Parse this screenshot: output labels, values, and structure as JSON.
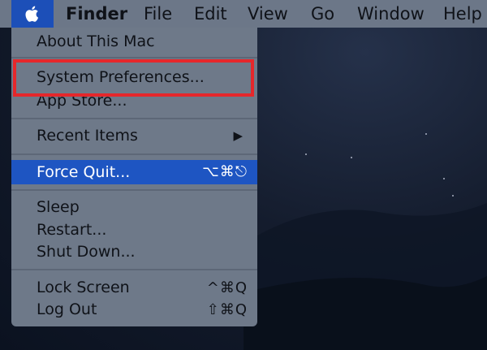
{
  "menubar": {
    "apple_icon": "apple-icon",
    "items": [
      "Finder",
      "File",
      "Edit",
      "View",
      "Go",
      "Window",
      "Help"
    ]
  },
  "apple_menu": {
    "items": [
      {
        "label": "About This Mac"
      },
      {
        "label": "System Preferences..."
      },
      {
        "label": "App Store..."
      },
      {
        "label": "Recent Items",
        "submenu_icon": "triangle-right-icon"
      },
      {
        "label": "Force Quit...",
        "shortcut": "⌥⌘⎋",
        "highlighted": true
      },
      {
        "label": "Sleep"
      },
      {
        "label": "Restart..."
      },
      {
        "label": "Shut Down..."
      },
      {
        "label": "Lock Screen",
        "shortcut": "^⌘Q"
      },
      {
        "label": "Log Out",
        "shortcut": "⇧⌘Q"
      }
    ]
  },
  "colors": {
    "menubar": "#6c7788",
    "menu_bg": "#6e7989",
    "highlight": "#1e55c2",
    "callout": "#e5272b",
    "desktop": "#141c2d"
  }
}
